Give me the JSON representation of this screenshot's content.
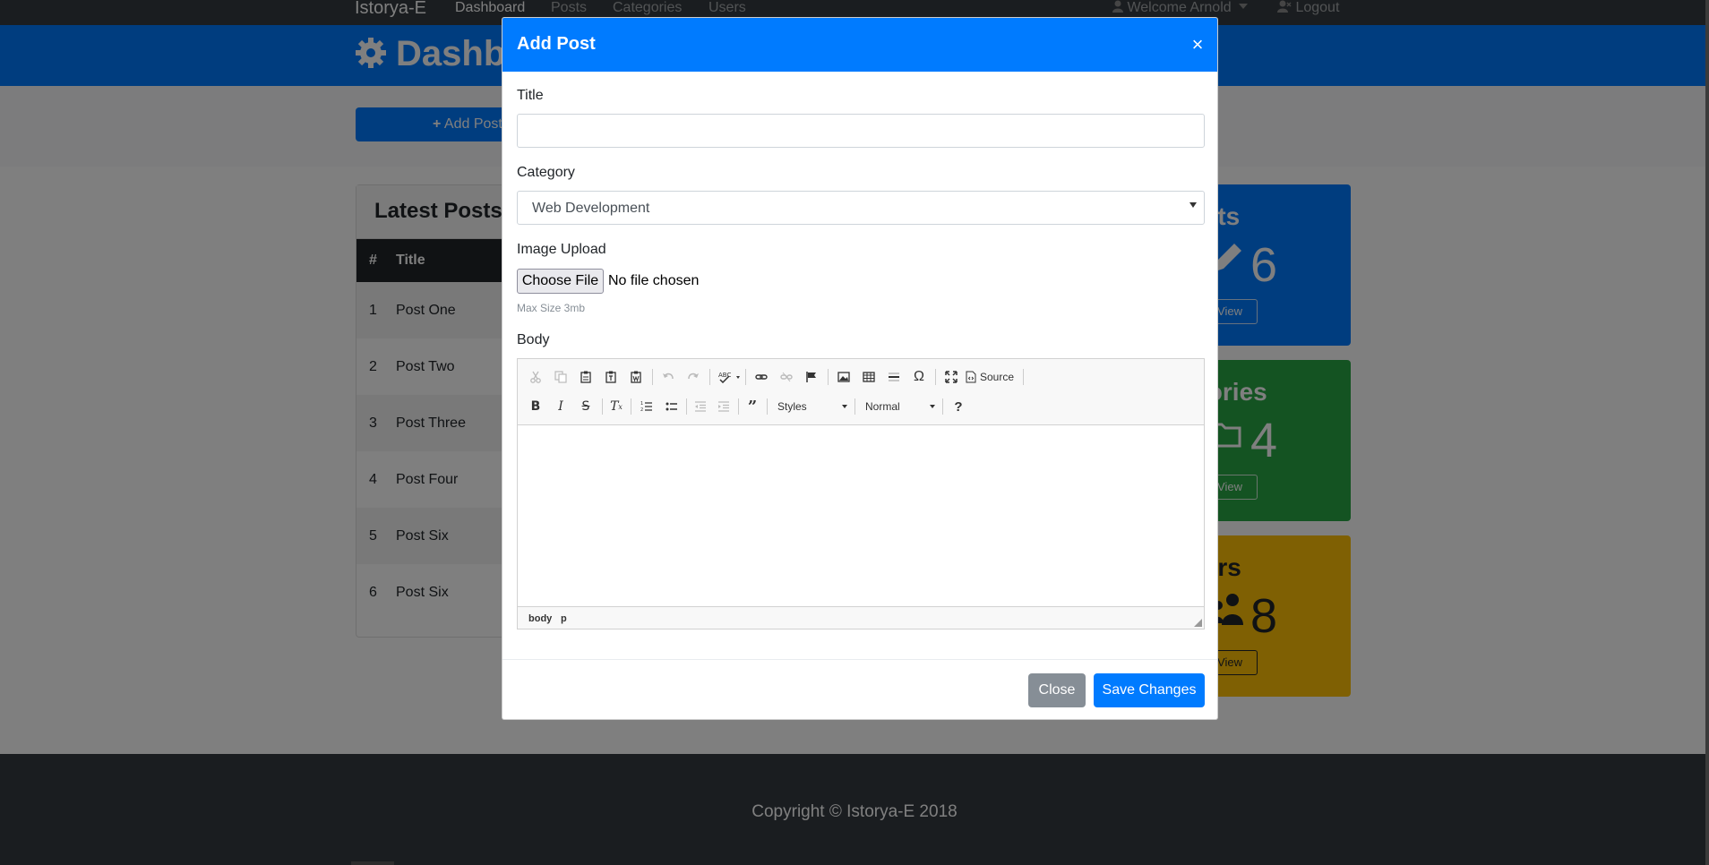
{
  "navbar": {
    "brand": "Istorya-E",
    "links": [
      "Dashboard",
      "Posts",
      "Categories",
      "Users"
    ],
    "welcome": "Welcome Arnold",
    "logout": "Logout"
  },
  "header": {
    "title": "Dashboard"
  },
  "actions": {
    "add_post": "Add Post"
  },
  "latest": {
    "title": "Latest Posts",
    "columns": [
      "#",
      "Title"
    ],
    "rows": [
      {
        "num": "1",
        "title": "Post One"
      },
      {
        "num": "2",
        "title": "Post Two"
      },
      {
        "num": "3",
        "title": "Post Three"
      },
      {
        "num": "4",
        "title": "Post Four"
      },
      {
        "num": "5",
        "title": "Post Six"
      },
      {
        "num": "6",
        "title": "Post Six"
      }
    ]
  },
  "stats": [
    {
      "title": "Posts",
      "count": "6",
      "view": "View",
      "color": "#007bff"
    },
    {
      "title": "Categories",
      "count": "4",
      "view": "View",
      "color": "#28a745"
    },
    {
      "title": "Users",
      "count": "8",
      "view": "View",
      "color": "#ffc107"
    }
  ],
  "footer": {
    "text": "Copyright © Istorya-E 2018"
  },
  "modal": {
    "title": "Add Post",
    "close_glyph": "×",
    "title_label": "Title",
    "title_value": "",
    "category_label": "Category",
    "category_value": "Web Development",
    "image_label": "Image Upload",
    "choose_file": "Choose File",
    "no_file": "No file chosen",
    "max_size": "Max Size 3mb",
    "body_label": "Body",
    "editor": {
      "source": "Source",
      "styles": "Styles",
      "format": "Normal",
      "path": [
        "body",
        "p"
      ]
    },
    "close_button": "Close",
    "save_button": "Save Changes"
  },
  "colors": {
    "primary": "#007bff",
    "success": "#28a745",
    "warning": "#ffc107",
    "dark": "#343a40"
  }
}
